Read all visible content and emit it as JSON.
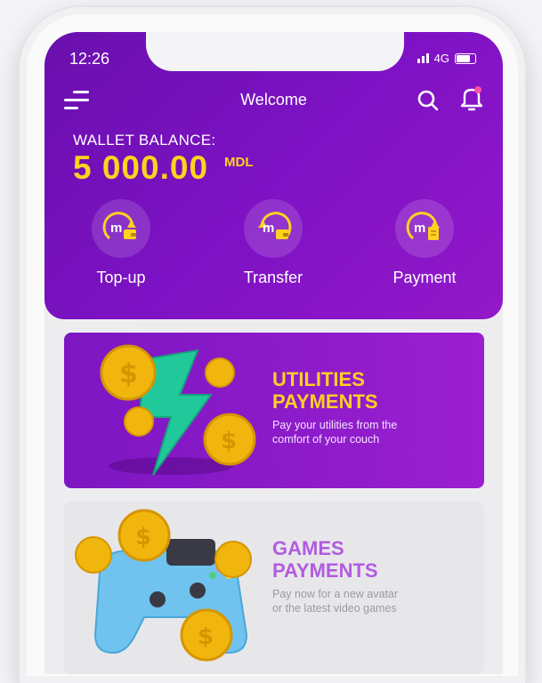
{
  "status_bar": {
    "time": "12:26",
    "network": "4G"
  },
  "header": {
    "title": "Welcome"
  },
  "wallet": {
    "label": "WALLET BALANCE:",
    "amount": "5 000.00",
    "currency": "MDL"
  },
  "actions": [
    {
      "label": "Top-up",
      "icon": "wallet-topup-icon"
    },
    {
      "label": "Transfer",
      "icon": "transfer-icon"
    },
    {
      "label": "Payment",
      "icon": "payment-icon"
    }
  ],
  "cards": [
    {
      "title_line1": "UTILITIES",
      "title_line2": "PAYMENTS",
      "desc_line1": "Pay your utilities from the",
      "desc_line2": "comfort of your couch",
      "title_color": "#ffcf24"
    },
    {
      "title_line1": "GAMES",
      "title_line2": "PAYMENTS",
      "desc_line1": "Pay now for a new avatar",
      "desc_line2": "or the latest video games",
      "title_color": "#b25bdf"
    }
  ],
  "colors": {
    "accent": "#7d12c4",
    "gold": "#ffd21f",
    "notification_dot": "#ff4fa0"
  }
}
